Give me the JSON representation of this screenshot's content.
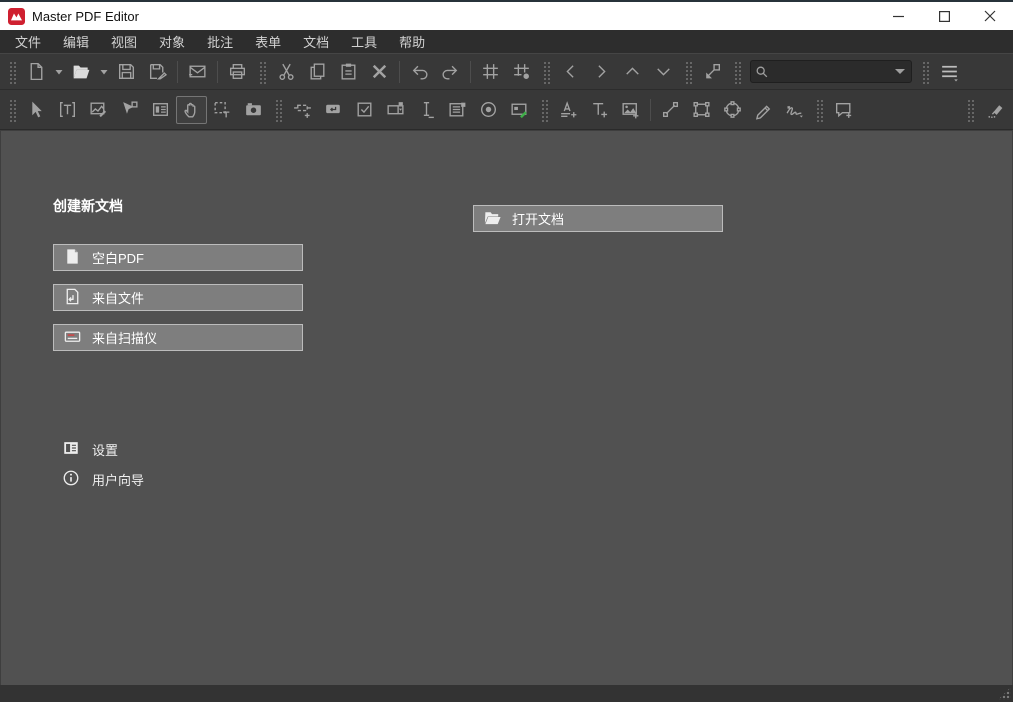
{
  "window": {
    "title": "Master PDF Editor",
    "controls": {
      "minimize": "minimize",
      "maximize": "maximize",
      "close": "close"
    }
  },
  "menubar": {
    "items": [
      "文件",
      "编辑",
      "视图",
      "对象",
      "批注",
      "表单",
      "文档",
      "工具",
      "帮助"
    ]
  },
  "toolbars": {
    "main": {
      "items": [
        "handle",
        "new-document",
        "dropdown-arrow",
        "open-document",
        "dropdown-arrow",
        "save",
        "save-as",
        "sep",
        "email",
        "sep",
        "print",
        "handle",
        "cut",
        "copy",
        "paste",
        "delete",
        "sep",
        "undo",
        "redo",
        "sep",
        "grid",
        "snap-to-grid",
        "handle",
        "previous-view",
        "next-view",
        "page-up",
        "page-down",
        "handle",
        "fit-window",
        "handle",
        "search-box",
        "handle",
        "menu"
      ]
    },
    "tools": {
      "items": [
        "handle",
        "select-tool",
        "edit-text-tool",
        "edit-images-tool",
        "edit-forms-tool",
        "properties-tool",
        "hand-tool",
        "select-text-tool",
        "snapshot-tool",
        "handle",
        "link-tool",
        "button-field",
        "checkbox-field",
        "combobox-field",
        "text-field",
        "listbox-field",
        "radio-field",
        "signature-field",
        "handle",
        "text-annotation",
        "add-text",
        "add-image",
        "sep",
        "line-tool",
        "rectangle-tool",
        "ellipse-tool",
        "pencil-tool",
        "signature-tool",
        "handle",
        "sticky-note",
        "spacer",
        "handle",
        "eraser-tool"
      ],
      "active": "hand-tool"
    },
    "search": {
      "placeholder": "",
      "value": ""
    }
  },
  "welcome": {
    "create_heading": "创建新文档",
    "buttons": {
      "blank_pdf": "空白PDF",
      "from_file": "来自文件",
      "from_scanner": "来自扫描仪",
      "open_document": "打开文档"
    },
    "links": {
      "settings": "设置",
      "user_guide": "用户向导"
    }
  },
  "colors": {
    "logo_red": "#cf2030",
    "titlebar_bg": "#ffffff",
    "menubar_bg": "#2d2d2d",
    "toolbar_bg": "#383838",
    "content_bg": "#515151",
    "button_bg": "#7e7e7e",
    "button_border": "#bcbcbc",
    "accent_green": "#3fae49",
    "scanner_red": "#d04343"
  }
}
